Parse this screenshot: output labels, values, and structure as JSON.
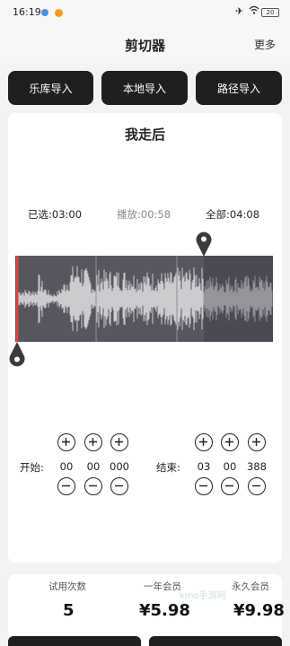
{
  "status_bar": {
    "time": "16:19",
    "battery": "20"
  },
  "header": {
    "title": "剪切器",
    "more": "更多"
  },
  "import_buttons": {
    "library": "乐库导入",
    "local": "本地导入",
    "path": "路径导入"
  },
  "song": {
    "title": "我走后"
  },
  "times": {
    "selected": "已选:03:00",
    "playing": "播放:00:58",
    "total": "全部:04:08"
  },
  "start": {
    "label": "开始:",
    "min": "00",
    "sec": "00",
    "ms": "000"
  },
  "end": {
    "label": "结束:",
    "min": "03",
    "sec": "00",
    "ms": "388"
  },
  "plans": {
    "trial_label": "试用次数",
    "trial_value": "5",
    "year_label": "一年会员",
    "year_value": "¥5.98",
    "life_label": "永久会员",
    "life_value": "¥9.98"
  },
  "watermark": "kmo手游网",
  "colors": {
    "accent_dark": "#1f1f21",
    "wave_bg": "#56565f",
    "wave_unselected": "#4a4a52",
    "marker_red": "#e0443a"
  }
}
